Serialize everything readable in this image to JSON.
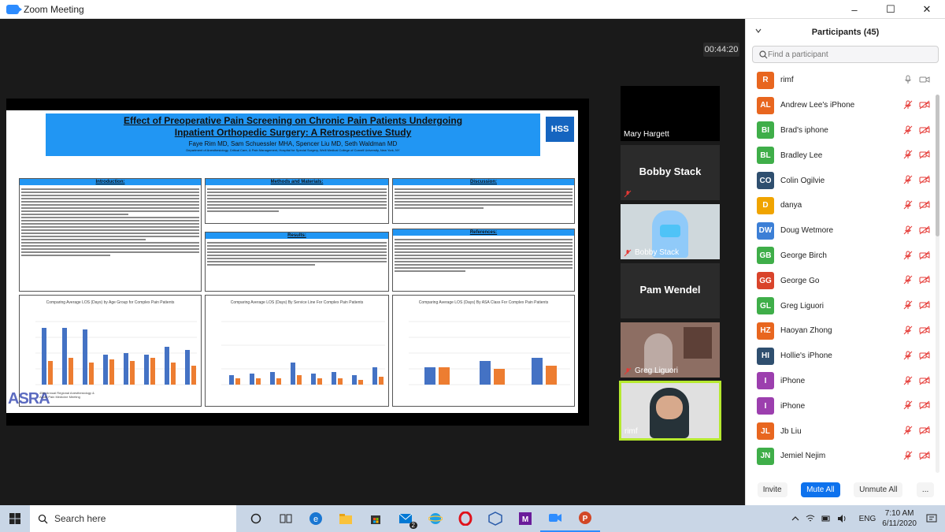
{
  "window": {
    "title": "Zoom Meeting",
    "buttons": [
      "–",
      "☐",
      "✕"
    ]
  },
  "meeting": {
    "timer": "00:44:20",
    "slide": {
      "title_line1": "Effect of Preoperative Pain Screening on Chronic Pain Patients Undergoing",
      "title_line2": "Inpatient Orthopedic Surgery: A Retrospective Study",
      "authors": "Faye Rim MD, Sam Schuessler MHA, Spencer Liu MD, Seth Waldman MD",
      "department": "Department of Anesthesiology, Critical Care, & Pain Management, Hospital for Special Surgery, Weill Medical College of Cornell University, New York, NY",
      "logo": "HSS",
      "sections": {
        "intro": "Introduction:",
        "methods": "Methods and Materials:",
        "results": "Results:",
        "discussion": "Discussion:",
        "references": "References:"
      },
      "charts": [
        {
          "title": "Comparing Average LOS (Days) by Age Group for Complex Pain Patients"
        },
        {
          "title": "Comparing Average LOS (Days) By Service Line For Complex Pain Patients"
        },
        {
          "title": "Comparing Average LOS (Days) By ASA Class For Complex Pain Patients"
        }
      ],
      "society_logo": "ASRA",
      "society_text": "45th Annual Regional Anesthesiology & Acute Pain Medicine Meeting"
    },
    "tiles": [
      {
        "name": "Mary Hargett",
        "style": "video"
      },
      {
        "name": "Bobby Stack",
        "style": "name"
      },
      {
        "name": "Bobby Stack",
        "style": "video"
      },
      {
        "name": "Pam Wendel",
        "style": "name"
      },
      {
        "name": "Greg Liguori",
        "style": "video"
      },
      {
        "name": "rimf",
        "style": "video-active"
      }
    ]
  },
  "participants": {
    "header": "Participants (45)",
    "search_placeholder": "Find a participant",
    "list": [
      {
        "initials": "R",
        "name": "rimf",
        "color": "#e8661f",
        "muted": false
      },
      {
        "initials": "AL",
        "name": "Andrew Lee's iPhone",
        "color": "#e8661f",
        "muted": true
      },
      {
        "initials": "BI",
        "name": "Brad's iphone",
        "color": "#3fae49",
        "muted": true
      },
      {
        "initials": "BL",
        "name": "Bradley Lee",
        "color": "#3fae49",
        "muted": true
      },
      {
        "initials": "CO",
        "name": "Colin Ogilvie",
        "color": "#2f4f6f",
        "muted": true
      },
      {
        "initials": "D",
        "name": "danya",
        "color": "#f0a400",
        "muted": true
      },
      {
        "initials": "DW",
        "name": "Doug Wetmore",
        "color": "#3c7fd6",
        "muted": true
      },
      {
        "initials": "GB",
        "name": "George Birch",
        "color": "#3fae49",
        "muted": true
      },
      {
        "initials": "GG",
        "name": "George Go",
        "color": "#d9442b",
        "muted": true
      },
      {
        "initials": "GL",
        "name": "Greg Liguori",
        "color": "#3fae49",
        "muted": true
      },
      {
        "initials": "HZ",
        "name": "Haoyan Zhong",
        "color": "#e8661f",
        "muted": true
      },
      {
        "initials": "HI",
        "name": "Hollie's iPhone",
        "color": "#2f4f6f",
        "muted": true
      },
      {
        "initials": "I",
        "name": "iPhone",
        "color": "#9c3fae",
        "muted": true
      },
      {
        "initials": "I",
        "name": "iPhone",
        "color": "#9c3fae",
        "muted": true
      },
      {
        "initials": "JL",
        "name": "Jb Liu",
        "color": "#e8661f",
        "muted": true
      },
      {
        "initials": "JN",
        "name": "Jemiel Nejim",
        "color": "#3fae49",
        "muted": true
      }
    ],
    "footer": {
      "invite": "Invite",
      "mute_all": "Mute All",
      "unmute_all": "Unmute All",
      "more": "..."
    }
  },
  "taskbar": {
    "search_placeholder": "Search here",
    "language": "ENG",
    "time": "7:10 AM",
    "date": "6/11/2020",
    "badge": "2"
  }
}
